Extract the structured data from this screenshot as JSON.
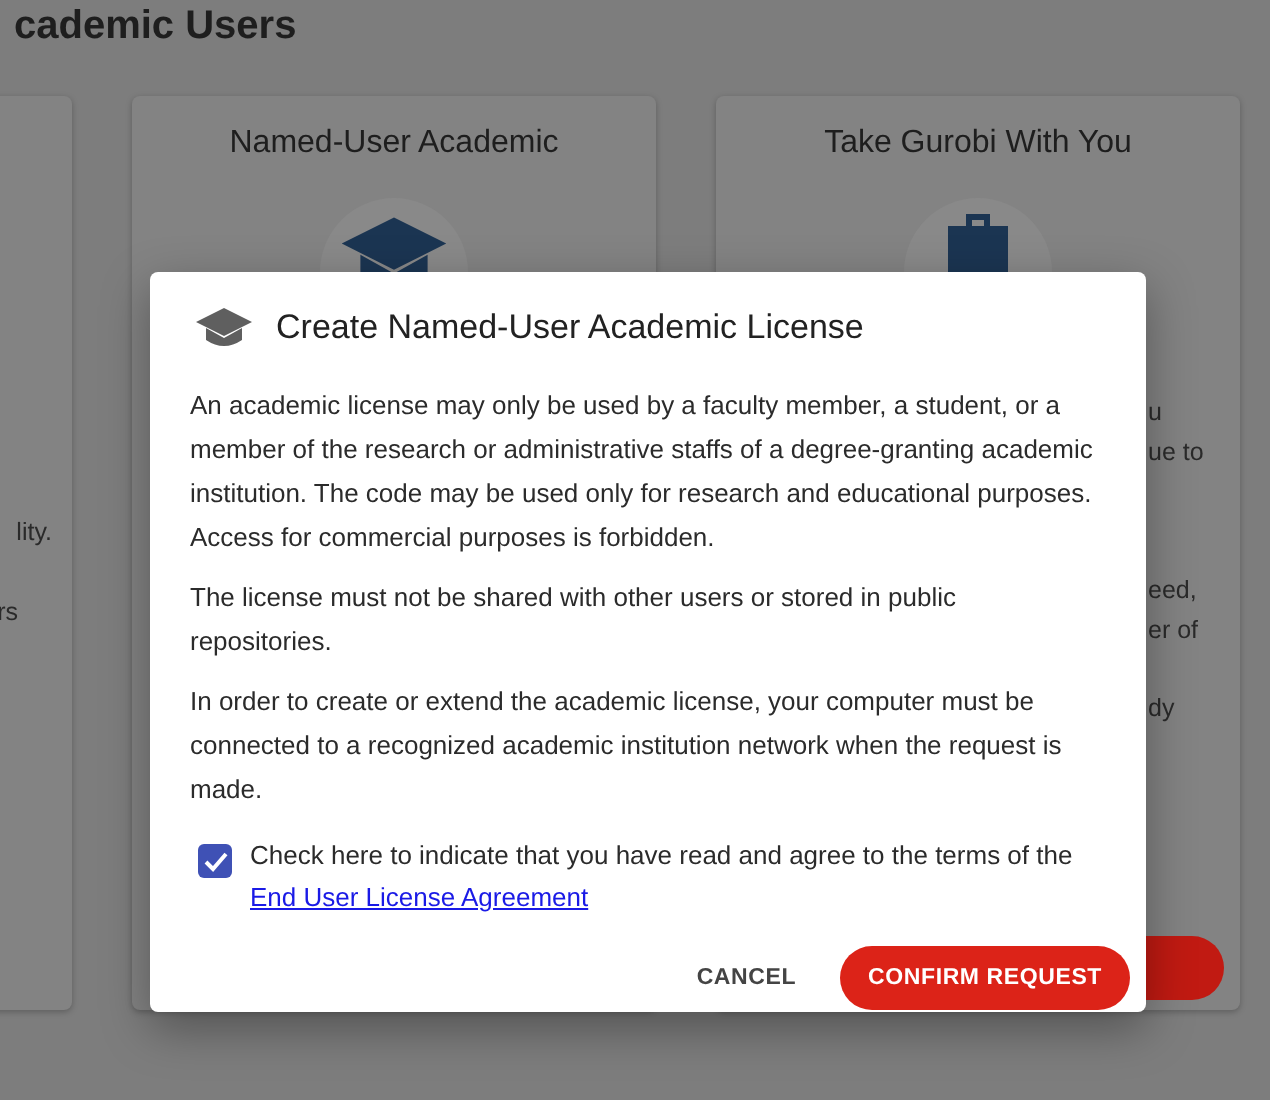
{
  "page": {
    "title": "cademic Users"
  },
  "cards": [
    {
      "kind": "partial-left",
      "fragments": [
        "lity.",
        "rs"
      ]
    },
    {
      "kind": "cap",
      "title": "Named-User Academic"
    },
    {
      "kind": "briefcase",
      "title": "Take Gurobi With You",
      "fragments": [
        "u",
        "ue to",
        "eed,",
        "er of",
        "dy"
      ]
    }
  ],
  "dialog": {
    "title": "Create Named-User Academic License",
    "paragraphs": [
      "An academic license may only be used by a faculty member, a student, or a member of the research or administrative staffs of a degree-granting academic institution. The code may be used only for research and educational purposes. Access for commercial purposes is forbidden.",
      "The license must not be shared with other users or stored in public repositories.",
      "In order to create or extend the academic license, your computer must be connected to a recognized academic institution network when the request is made."
    ],
    "agreement": {
      "checked": true,
      "text": "Check here to indicate that you have read and agree to the terms of the",
      "link": "End User License Agreement"
    },
    "buttons": [
      {
        "label": "CANCEL",
        "kind": "text"
      },
      {
        "label": "CONFIRM REQUEST",
        "kind": "primary"
      }
    ]
  }
}
